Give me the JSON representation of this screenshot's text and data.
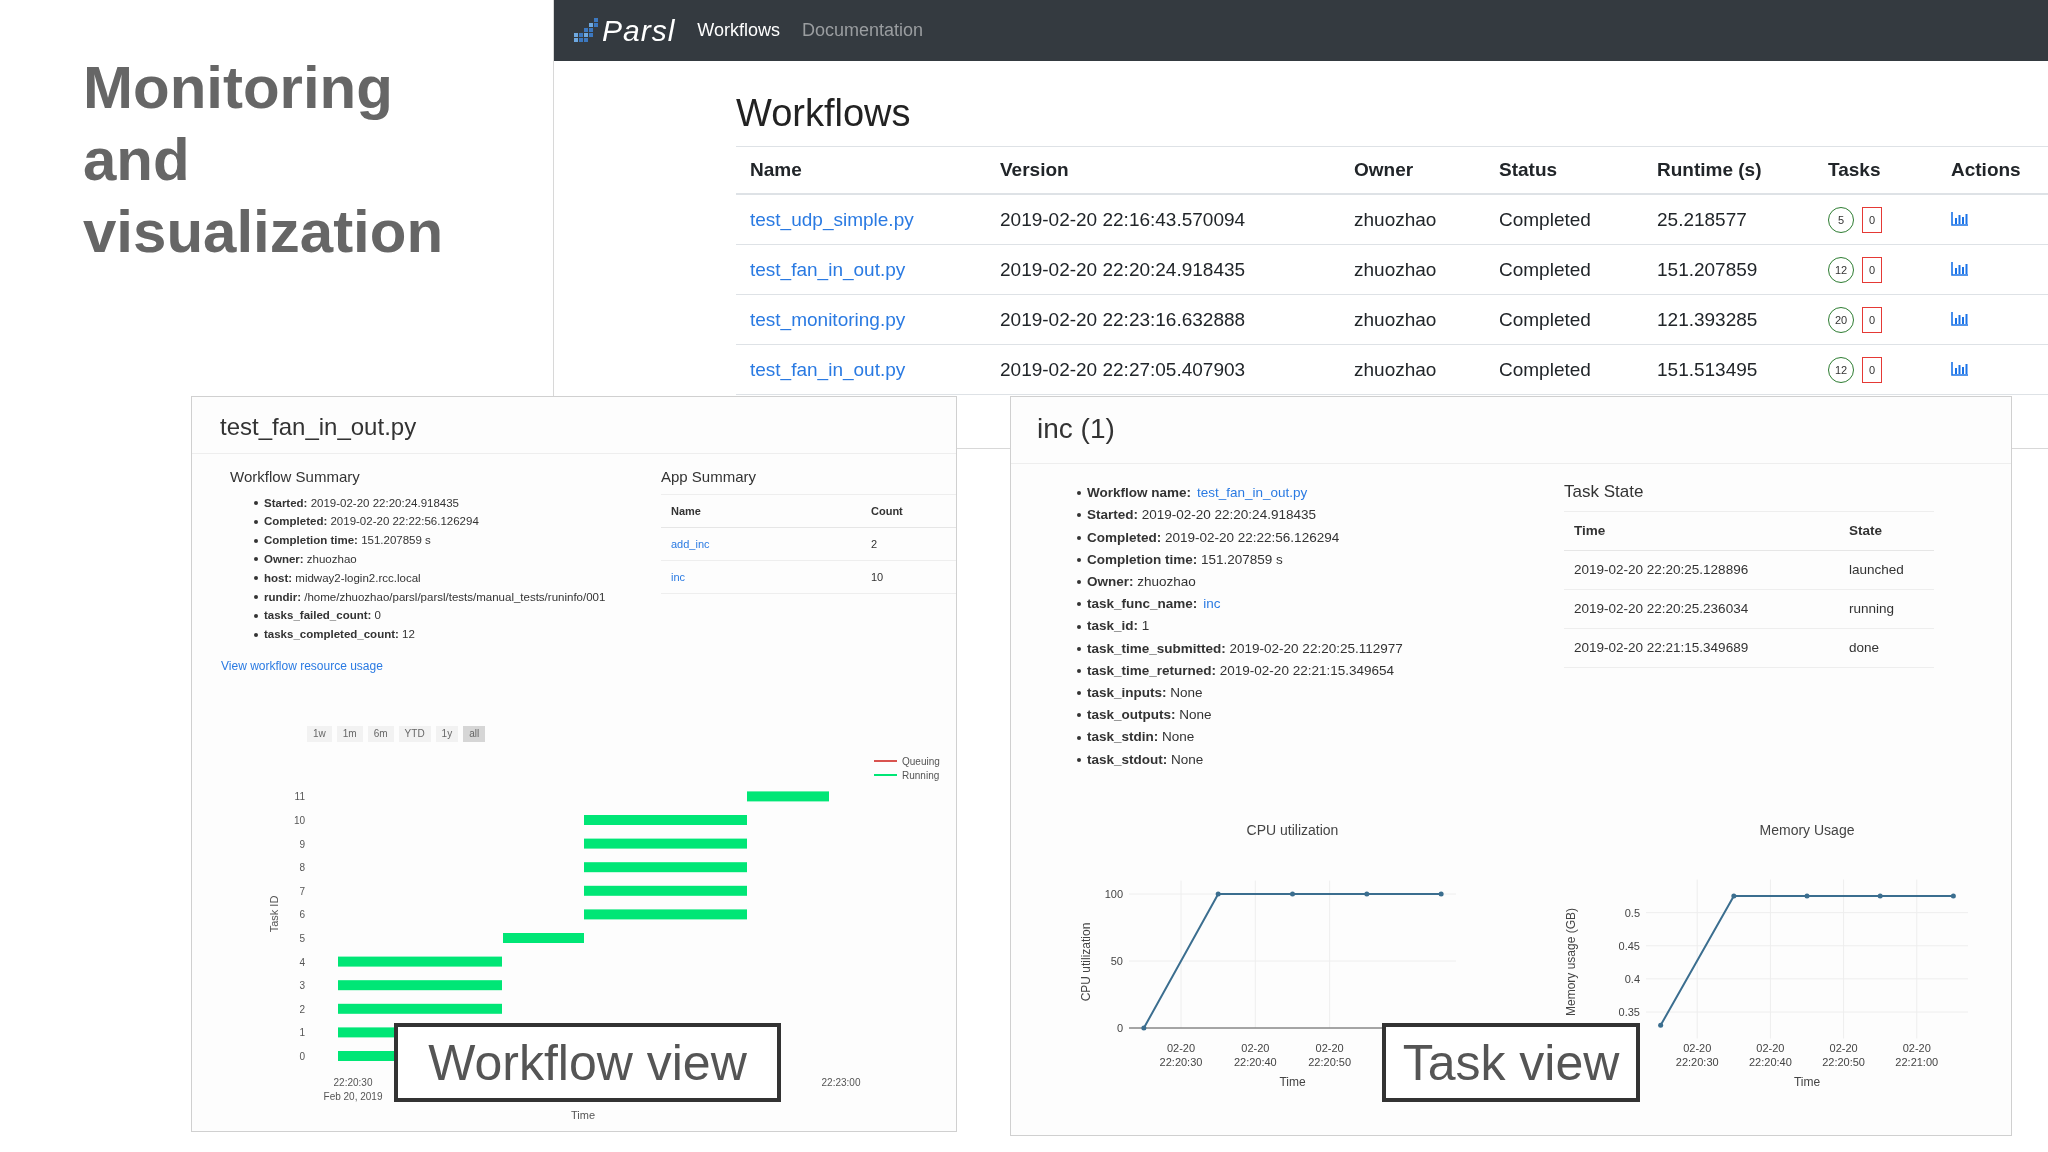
{
  "slide_title": "Monitoring and visualization",
  "top_window": {
    "brand": "Parsl",
    "nav": [
      {
        "label": "Workflows",
        "selected": true
      },
      {
        "label": "Documentation",
        "selected": false
      }
    ],
    "heading": "Workflows",
    "columns": [
      "Name",
      "Version",
      "Owner",
      "Status",
      "Runtime (s)",
      "Tasks",
      "Actions"
    ],
    "rows": [
      {
        "name": "test_udp_simple.py",
        "version": "2019-02-20 22:16:43.570094",
        "owner": "zhuozhao",
        "status": "Completed",
        "runtime": "25.218577",
        "tasks_done": "5",
        "tasks_failed": "0"
      },
      {
        "name": "test_fan_in_out.py",
        "version": "2019-02-20 22:20:24.918435",
        "owner": "zhuozhao",
        "status": "Completed",
        "runtime": "151.207859",
        "tasks_done": "12",
        "tasks_failed": "0"
      },
      {
        "name": "test_monitoring.py",
        "version": "2019-02-20 22:23:16.632888",
        "owner": "zhuozhao",
        "status": "Completed",
        "runtime": "121.393285",
        "tasks_done": "20",
        "tasks_failed": "0"
      },
      {
        "name": "test_fan_in_out.py",
        "version": "2019-02-20 22:27:05.407903",
        "owner": "zhuozhao",
        "status": "Completed",
        "runtime": "151.513495",
        "tasks_done": "12",
        "tasks_failed": "0"
      }
    ]
  },
  "workflow_view": {
    "title": "test_fan_in_out.py",
    "summary_heading": "Workflow Summary",
    "summary": [
      {
        "label": "Started:",
        "value": "2019-02-20 22:20:24.918435"
      },
      {
        "label": "Completed:",
        "value": "2019-02-20 22:22:56.126294"
      },
      {
        "label": "Completion time:",
        "value": "151.207859 s"
      },
      {
        "label": "Owner:",
        "value": "zhuozhao"
      },
      {
        "label": "host:",
        "value": "midway2-login2.rcc.local"
      },
      {
        "label": "rundir:",
        "value": "/home/zhuozhao/parsl/parsl/tests/manual_tests/runinfo/001"
      },
      {
        "label": "tasks_failed_count:",
        "value": "0"
      },
      {
        "label": "tasks_completed_count:",
        "value": "12"
      }
    ],
    "app_heading": "App Summary",
    "app_columns": [
      "Name",
      "Count"
    ],
    "apps": [
      {
        "name": "add_inc",
        "count": "2"
      },
      {
        "name": "inc",
        "count": "10"
      }
    ],
    "resource_link": "View workflow resource usage",
    "ranges": [
      {
        "label": "1w",
        "selected": false
      },
      {
        "label": "1m",
        "selected": false
      },
      {
        "label": "6m",
        "selected": false
      },
      {
        "label": "YTD",
        "selected": false
      },
      {
        "label": "1y",
        "selected": false
      },
      {
        "label": "all",
        "selected": true
      }
    ],
    "gantt": {
      "ylabel": "Task ID",
      "xlabel": "Time",
      "yticks": [
        "11",
        "10",
        "9",
        "8",
        "7",
        "6",
        "5",
        "4",
        "3",
        "2",
        "1",
        "0"
      ],
      "xticks": [
        {
          "label": "22:20:30",
          "sublabel": "Feb 20, 2019"
        },
        {
          "label": "22:23:00"
        }
      ],
      "legend": [
        {
          "name": "Queuing",
          "color": "#d9534f"
        },
        {
          "name": "Running",
          "color": "#00e676"
        }
      ]
    }
  },
  "task_view": {
    "title": "inc (1)",
    "details": [
      {
        "kind": "link",
        "label": "Workflow name:",
        "value": "test_fan_in_out.py"
      },
      {
        "kind": "text",
        "label": "Started:",
        "value": "2019-02-20 22:20:24.918435"
      },
      {
        "kind": "text",
        "label": "Completed:",
        "value": "2019-02-20 22:22:56.126294"
      },
      {
        "kind": "text",
        "label": "Completion time:",
        "value": "151.207859 s"
      },
      {
        "kind": "text",
        "label": "Owner:",
        "value": "zhuozhao"
      },
      {
        "kind": "link",
        "label": "task_func_name:",
        "value": "inc"
      },
      {
        "kind": "text",
        "label": "task_id:",
        "value": "1"
      },
      {
        "kind": "text",
        "label": "task_time_submitted:",
        "value": "2019-02-20 22:20:25.112977"
      },
      {
        "kind": "text",
        "label": "task_time_returned:",
        "value": "2019-02-20 22:21:15.349654"
      },
      {
        "kind": "text",
        "label": "task_inputs:",
        "value": "None"
      },
      {
        "kind": "text",
        "label": "task_outputs:",
        "value": "None"
      },
      {
        "kind": "text",
        "label": "task_stdin:",
        "value": "None"
      },
      {
        "kind": "text",
        "label": "task_stdout:",
        "value": "None"
      }
    ],
    "state_heading": "Task State",
    "state_columns": [
      "Time",
      "State"
    ],
    "states": [
      {
        "time": "2019-02-20 22:20:25.128896",
        "state": "launched"
      },
      {
        "time": "2019-02-20 22:20:25.236034",
        "state": "running"
      },
      {
        "time": "2019-02-20 22:21:15.349689",
        "state": "done"
      }
    ],
    "cpu": {
      "chart_data": {
        "type": "line",
        "title": "CPU utilization",
        "xlabel": "Time",
        "ylabel": "CPU utilization",
        "categories": [
          null,
          "02-20 22:20:30",
          null,
          "02-20 22:20:40",
          null,
          "02-20 22:20:50",
          null,
          null,
          null
        ],
        "series": [
          {
            "color": "#3b6e8f",
            "values": [
              0,
              null,
              100,
              null,
              100,
              null,
              100,
              null,
              100
            ]
          }
        ],
        "ylim": [
          0,
          110
        ],
        "yticks": [
          0,
          50,
          100
        ],
        "grid": true
      }
    },
    "memory": {
      "chart_data": {
        "type": "line",
        "title": "Memory Usage",
        "xlabel": "Time",
        "ylabel": "Memory usage (GB)",
        "categories": [
          null,
          "02-20 22:20:30",
          null,
          "02-20 22:20:40",
          null,
          "02-20 22:20:50",
          null,
          "02-20 22:21:00",
          null
        ],
        "series": [
          {
            "color": "#3b6e8f",
            "values": [
              0.33,
              null,
              0.525,
              null,
              0.525,
              null,
              0.525,
              null,
              0.525
            ]
          }
        ],
        "ylim": [
          0.31,
          0.55
        ],
        "yticks": [
          0.35,
          0.4,
          0.45,
          0.5
        ],
        "grid": true
      }
    }
  },
  "overlay_labels": [
    "Workflow view",
    "Task view"
  ]
}
